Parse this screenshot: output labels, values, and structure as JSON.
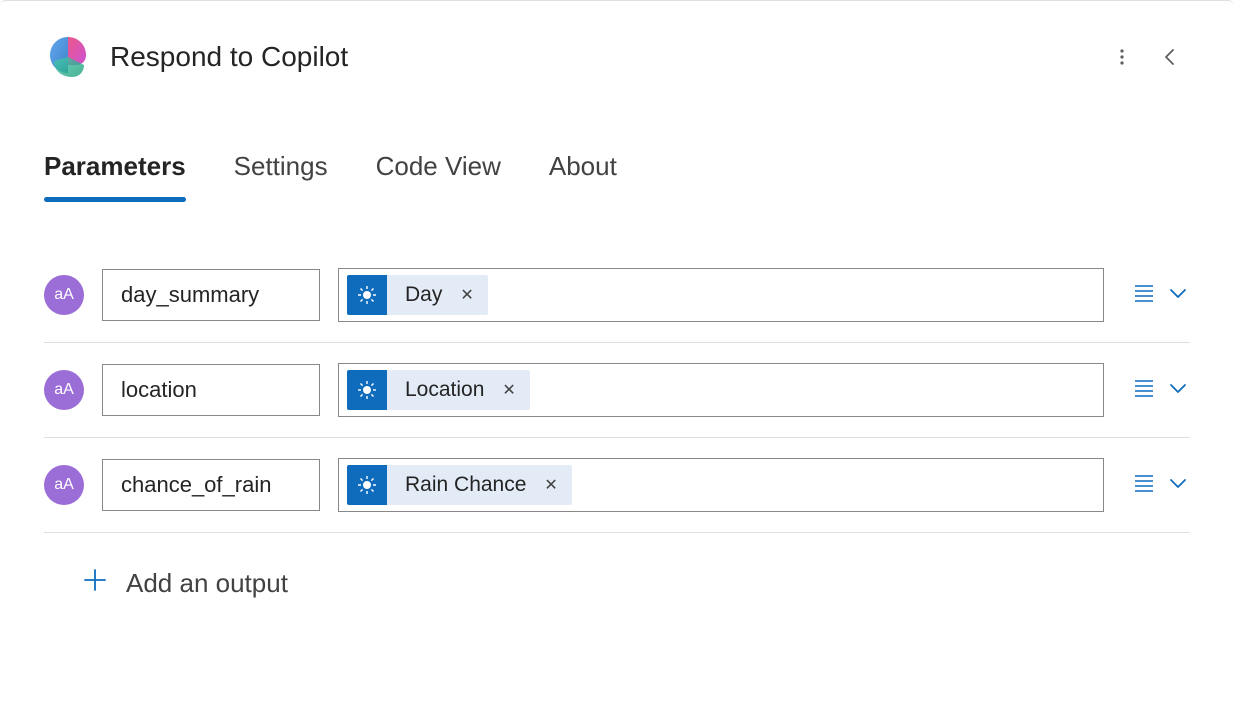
{
  "header": {
    "title": "Respond to Copilot"
  },
  "tabs": {
    "parameters": "Parameters",
    "settings": "Settings",
    "codeview": "Code View",
    "about": "About"
  },
  "parameters": [
    {
      "name": "day_summary",
      "token": "Day"
    },
    {
      "name": "location",
      "token": "Location"
    },
    {
      "name": "chance_of_rain",
      "token": "Rain Chance"
    }
  ],
  "add_output_label": "Add an output",
  "badge_text": "aA",
  "colors": {
    "accent": "#0f6cbd",
    "badge": "#9b6dd7",
    "token_bg": "#e3ecf6"
  }
}
